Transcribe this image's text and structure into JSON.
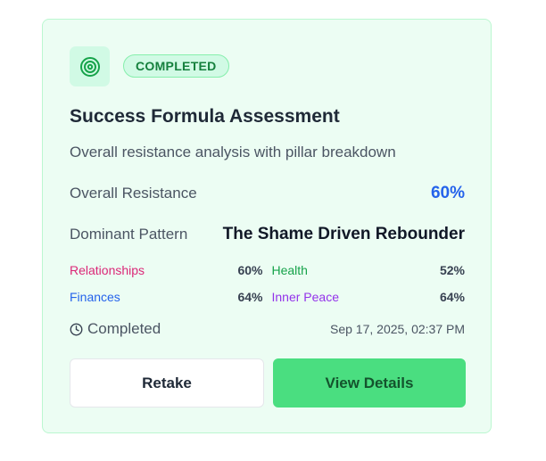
{
  "card": {
    "icon": "target-icon",
    "status_badge": "COMPLETED",
    "title": "Success Formula Assessment",
    "subtitle": "Overall resistance analysis with pillar breakdown",
    "overall_label": "Overall Resistance",
    "overall_value": "60%",
    "pattern_label": "Dominant Pattern",
    "pattern_value": "The Shame Driven Rebounder",
    "pillars": [
      {
        "name": "Relationships",
        "value": "60%",
        "color": "#db2777"
      },
      {
        "name": "Health",
        "value": "52%",
        "color": "#16a34a"
      },
      {
        "name": "Finances",
        "value": "64%",
        "color": "#2563eb"
      },
      {
        "name": "Inner Peace",
        "value": "64%",
        "color": "#9333ea"
      }
    ],
    "completed_label": "Completed",
    "completed_icon": "clock-icon",
    "completed_at": "Sep 17, 2025, 02:37 PM",
    "retake_label": "Retake",
    "view_details_label": "View Details"
  },
  "colors": {
    "accent_green": "#4ade80",
    "card_bg": "#ecfdf3",
    "overall_value": "#2563eb"
  }
}
